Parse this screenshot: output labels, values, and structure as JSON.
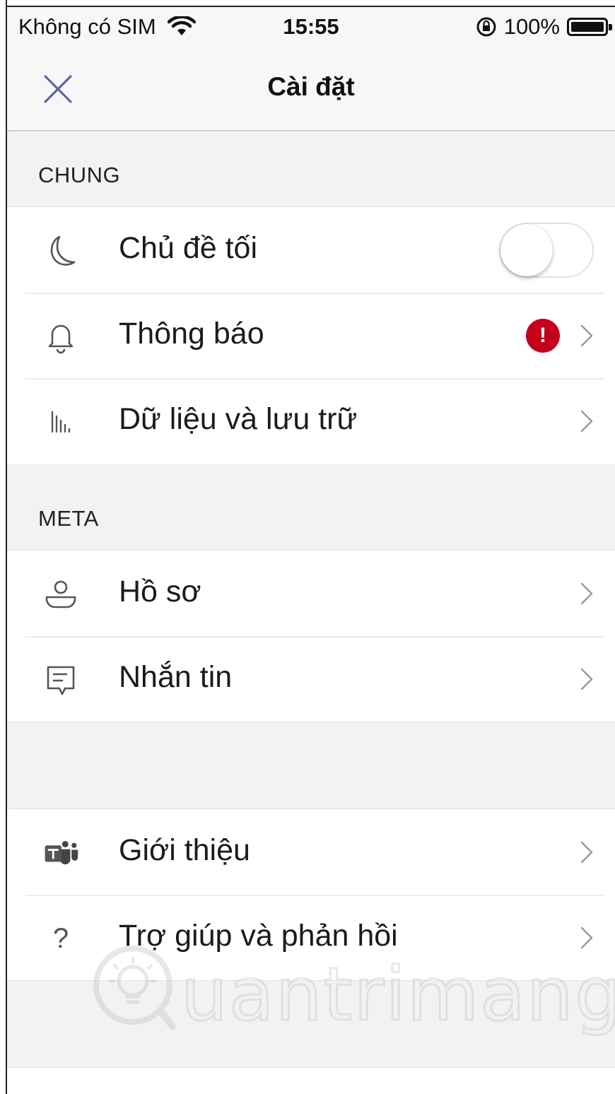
{
  "status_bar": {
    "carrier": "Không có SIM",
    "time": "15:55",
    "battery": "100%",
    "battery_level": 1.0
  },
  "nav": {
    "title": "Cài đặt",
    "close_icon": "close-icon"
  },
  "sections": {
    "general": {
      "header": "CHUNG",
      "items": [
        {
          "label": "Chủ đề tối",
          "icon": "moon-icon",
          "toggle_on": false
        },
        {
          "label": "Thông báo",
          "icon": "bell-icon",
          "badge": "!"
        },
        {
          "label": "Dữ liệu và lưu trữ",
          "icon": "data-bars-icon"
        }
      ]
    },
    "meta": {
      "header": "META",
      "items": [
        {
          "label": "Hồ sơ",
          "icon": "profile-icon"
        },
        {
          "label": "Nhắn tin",
          "icon": "message-icon"
        }
      ]
    },
    "about": {
      "items": [
        {
          "label": "Giới thiệu",
          "icon": "teams-logo-icon"
        },
        {
          "label": "Trợ giúp và phản hồi",
          "icon": "help-icon",
          "glyph": "?"
        }
      ]
    }
  },
  "watermark": {
    "text": "uantrimang"
  },
  "colors": {
    "accent": "#6264a7",
    "badge": "#c4001a",
    "background": "#f3f2f1"
  }
}
